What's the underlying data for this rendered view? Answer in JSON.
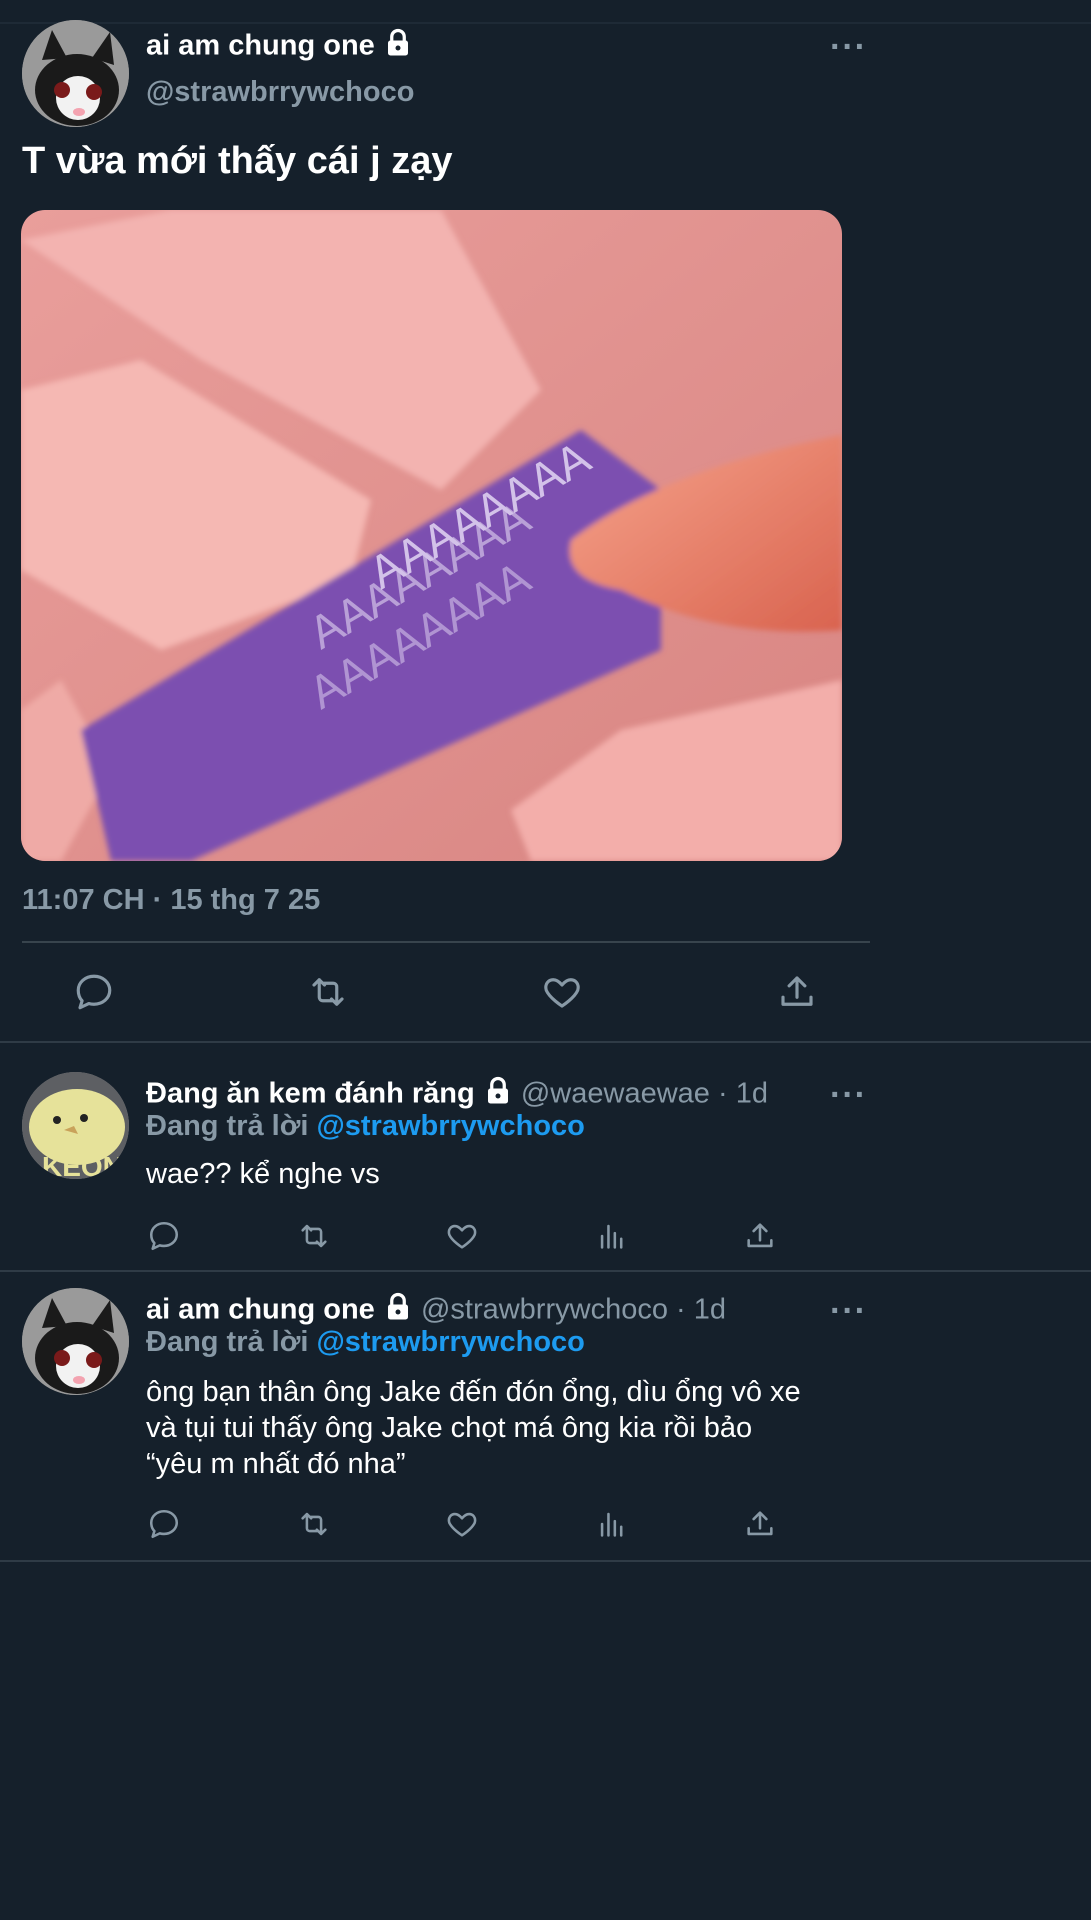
{
  "main_tweet": {
    "author_name": "ai am chung one",
    "author_handle": "@strawbrrywchoco",
    "text": "T vừa mới thấy cái j zạy",
    "image_text": "AAAAAAAA",
    "timestamp": "11:07 CH",
    "date": "15 thg 7 25",
    "dot": "·"
  },
  "replies": [
    {
      "author_name": "Đang ăn kem đánh răng",
      "author_handle": "@waewaewae",
      "age": "1d",
      "replying_to_label": "Đang trả lời",
      "replying_to_handle": "@strawbrrywchoco",
      "text": "wae?? kể nghe vs",
      "avatar_text": "KEON"
    },
    {
      "author_name": "ai am chung one",
      "author_handle": "@strawbrrywchoco",
      "age": "1d",
      "replying_to_label": "Đang trả lời",
      "replying_to_handle": "@strawbrrywchoco",
      "text_line1": "ông bạn thân ông Jake đến đón ổng, dìu ổng vô xe",
      "text_line2": "và tụi tui thấy ông Jake chọt má ông kia rồi bảo",
      "text_line3": "“yêu m nhất đó nha”"
    }
  ],
  "more_label": "···",
  "colors": {
    "background": "#15202b",
    "secondary_text": "#8899a6",
    "accent": "#1d9bf0",
    "divider": "#38444d"
  }
}
